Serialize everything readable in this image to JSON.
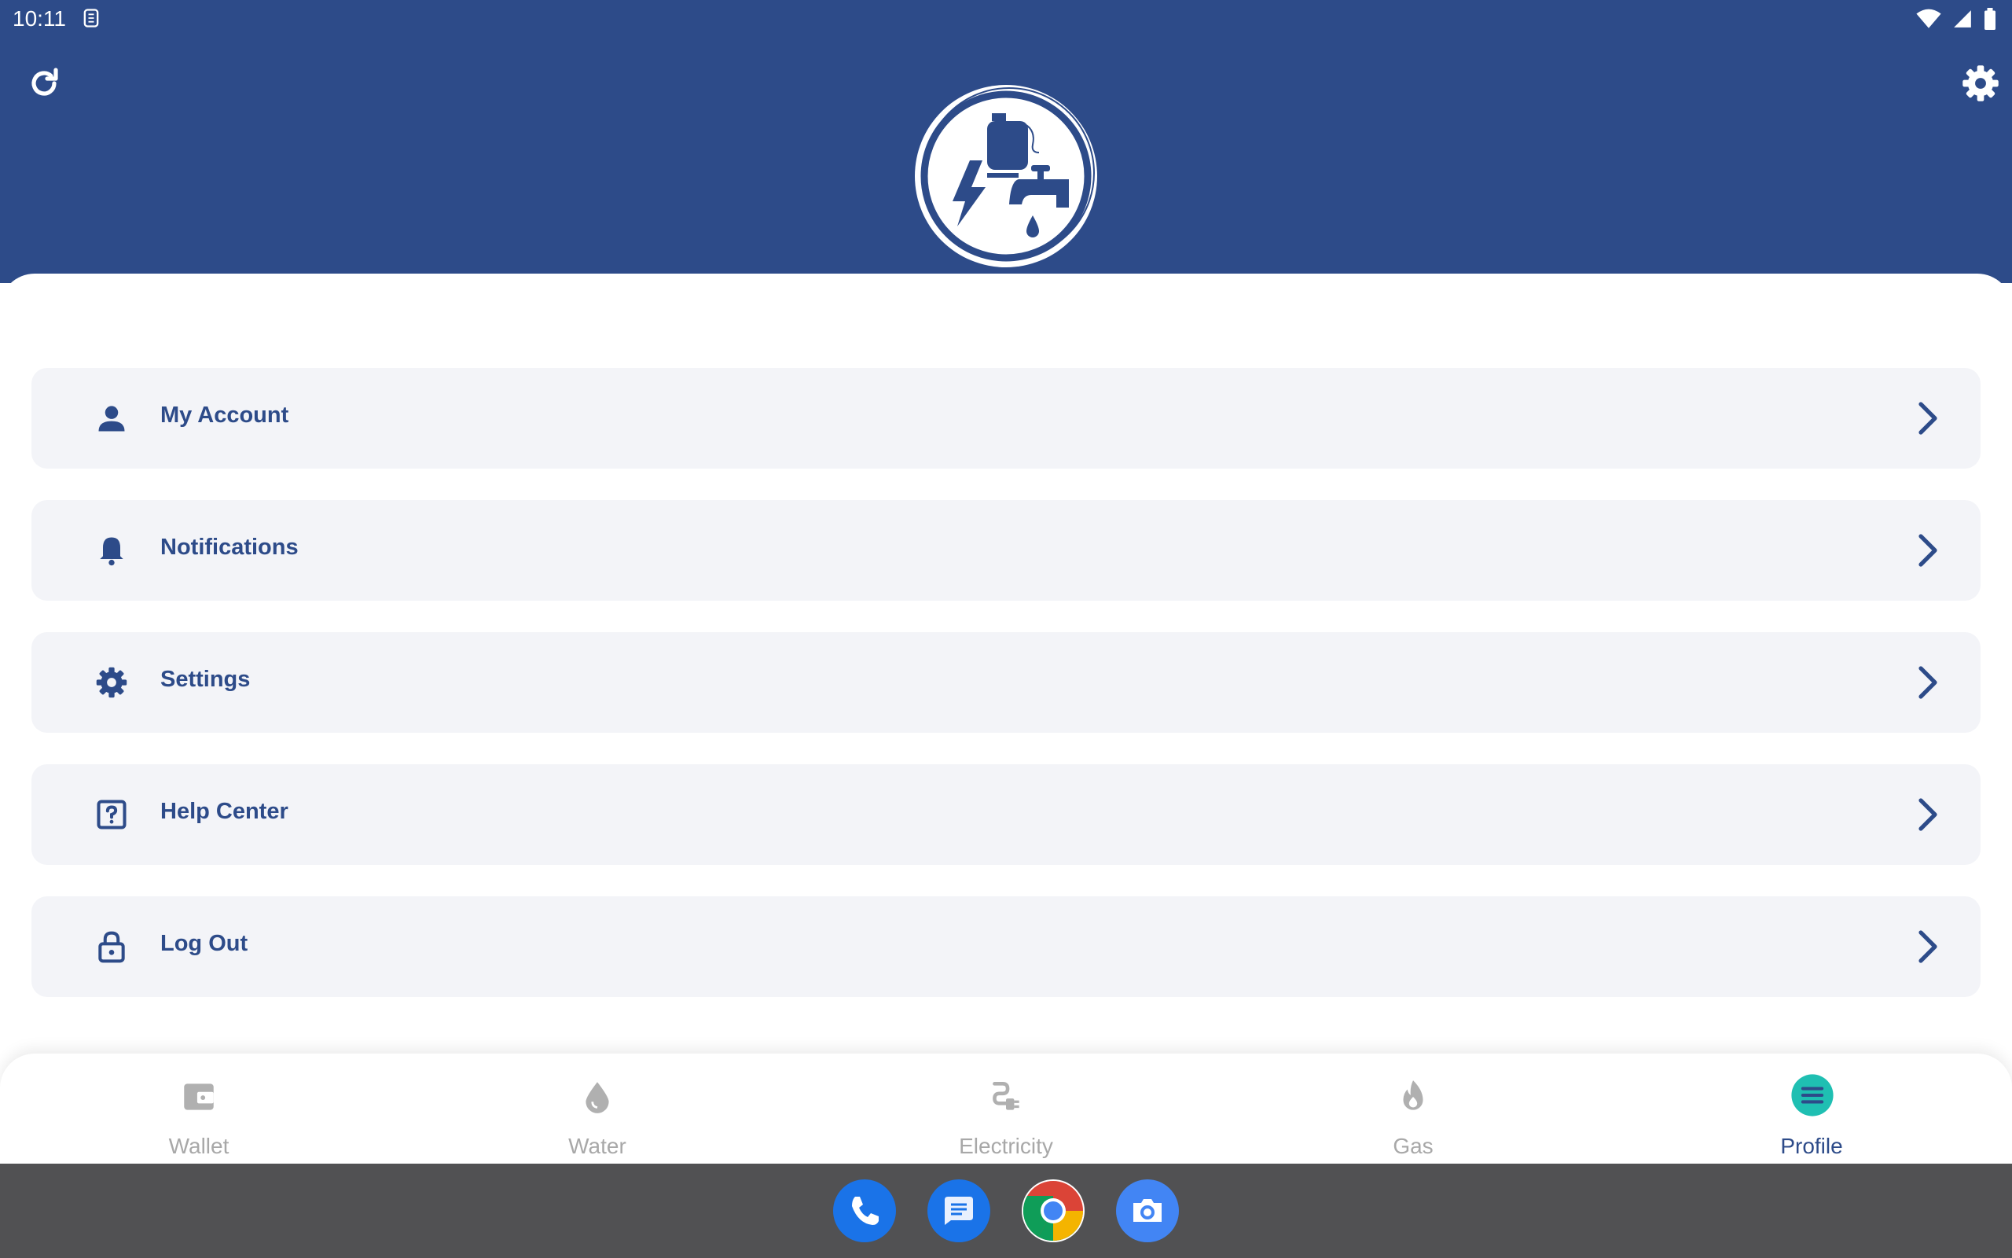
{
  "status_bar": {
    "time": "10:11"
  },
  "header": {
    "logo_icon": "utilities-logo-icon"
  },
  "menu": {
    "items": [
      {
        "label": "My Account",
        "icon": "person-icon"
      },
      {
        "label": "Notifications",
        "icon": "bell-icon"
      },
      {
        "label": "Settings",
        "icon": "gear-icon"
      },
      {
        "label": "Help Center",
        "icon": "help-icon"
      },
      {
        "label": "Log Out",
        "icon": "lock-icon"
      }
    ]
  },
  "bottom_nav": {
    "items": [
      {
        "label": "Wallet",
        "icon": "wallet-icon"
      },
      {
        "label": "Water",
        "icon": "water-drop-icon"
      },
      {
        "label": "Electricity",
        "icon": "plug-icon"
      },
      {
        "label": "Gas",
        "icon": "flame-icon"
      },
      {
        "label": "Profile",
        "icon": "menu-icon",
        "active": true
      }
    ]
  },
  "dock": {
    "apps": [
      "phone-icon",
      "messages-icon",
      "chrome-icon",
      "camera-icon"
    ]
  },
  "colors": {
    "primary": "#2d4b89",
    "menu_bg": "#f3f4f8",
    "inactive": "#a8a8a8",
    "active_badge": "#1fbfb2"
  }
}
